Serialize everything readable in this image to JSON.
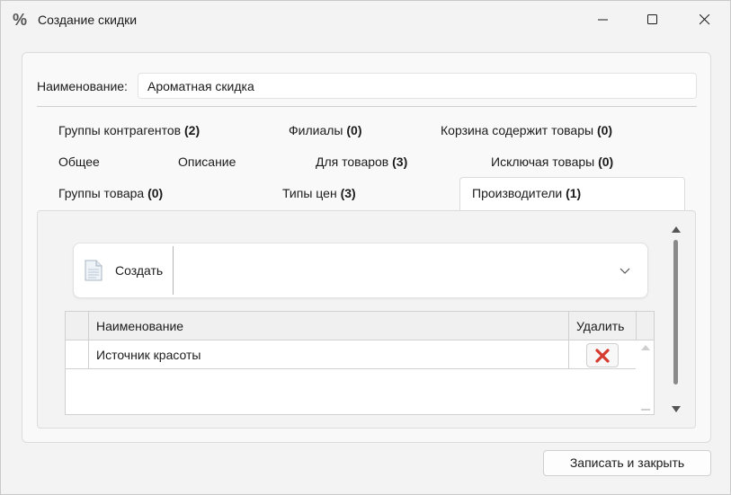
{
  "window": {
    "title": "Создание скидки",
    "icon": "percent-icon"
  },
  "form": {
    "name_label": "Наименование:",
    "name_value": "Ароматная скидка"
  },
  "tabs": [
    {
      "label": "Группы контрагентов",
      "count": "(2)"
    },
    {
      "label": "Филиалы",
      "count": "(0)"
    },
    {
      "label": "Корзина содержит товары",
      "count": "(0)"
    },
    {
      "label": "Общее",
      "count": ""
    },
    {
      "label": "Описание",
      "count": ""
    },
    {
      "label": "Для товаров",
      "count": "(3)"
    },
    {
      "label": "Исключая товары",
      "count": "(0)"
    },
    {
      "label": "Группы товара",
      "count": "(0)"
    },
    {
      "label": "Типы цен",
      "count": "(3)"
    },
    {
      "label": "Производители",
      "count": "(1)",
      "active": true
    }
  ],
  "toolbar": {
    "create_label": "Создать"
  },
  "grid": {
    "columns": [
      "Наименование",
      "Удалить"
    ],
    "rows": [
      {
        "name": "Источник красоты"
      }
    ]
  },
  "footer": {
    "save_close_label": "Записать и закрыть"
  },
  "colors": {
    "accent_delete": "#d63b2f",
    "panel_bg": "#f9f9f9"
  }
}
